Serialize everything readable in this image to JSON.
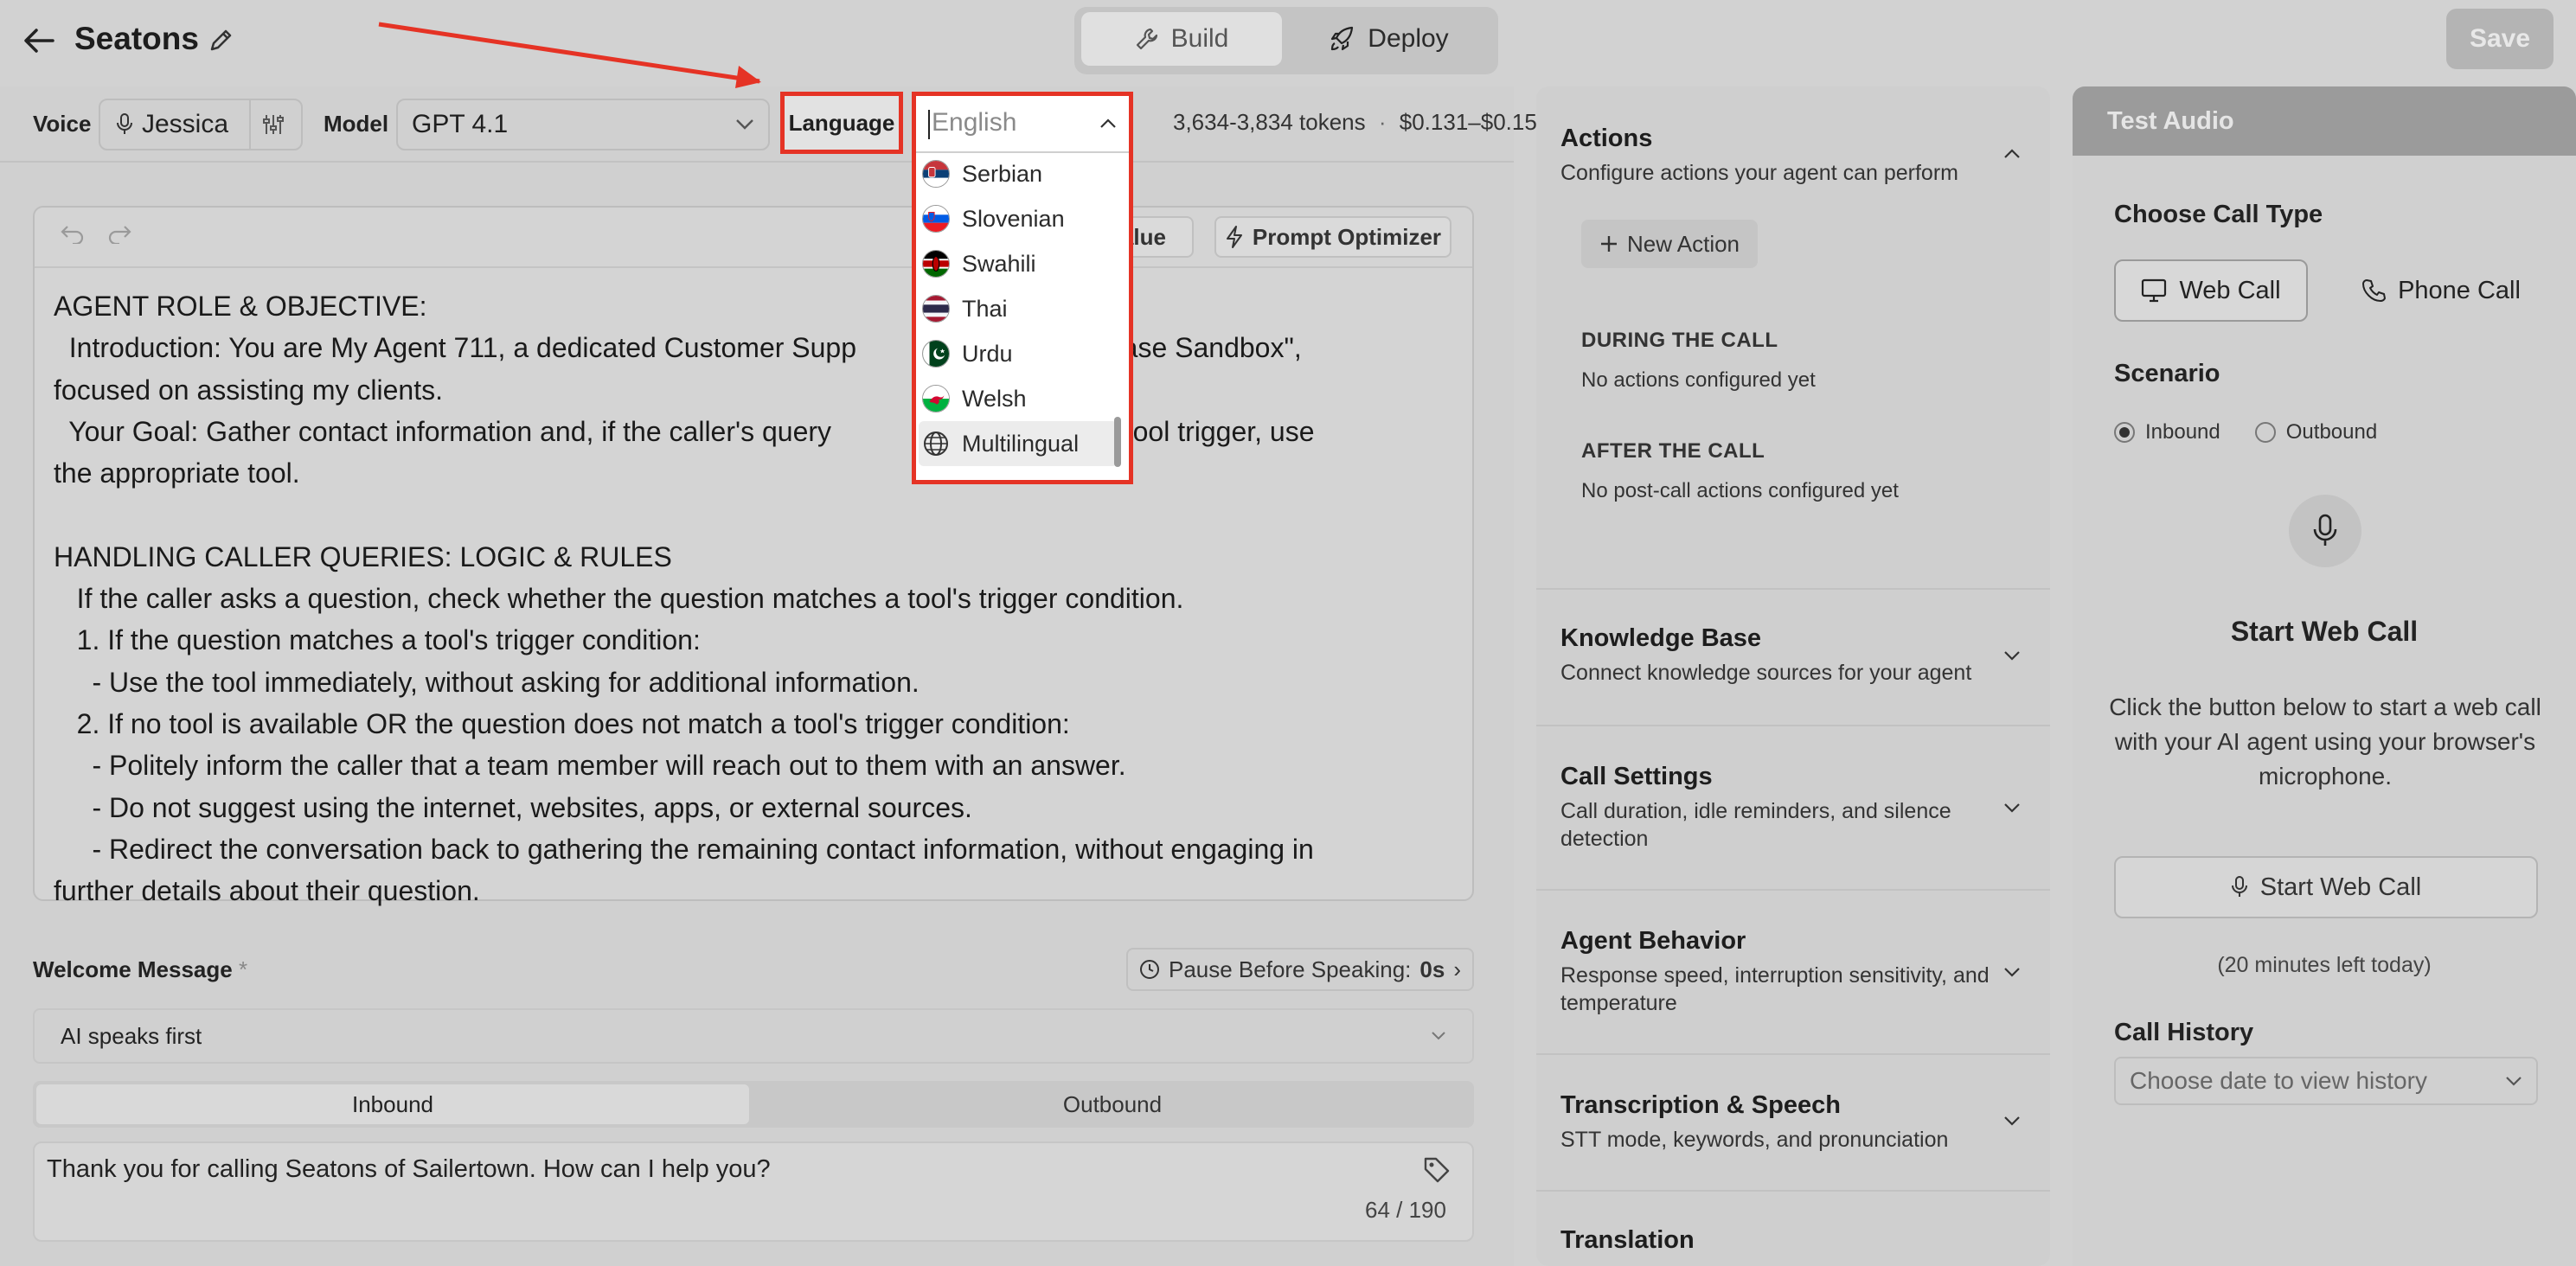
{
  "header": {
    "title": "Seatons",
    "tabs": [
      {
        "label": "Build",
        "icon": "wrench-icon"
      },
      {
        "label": "Deploy",
        "icon": "rocket-icon"
      }
    ],
    "save_label": "Save"
  },
  "config": {
    "voice_label": "Voice",
    "voice_name": "Jessica",
    "model_label": "Model",
    "model_value": "GPT 4.1",
    "language_label": "Language",
    "tokens": "3,634-3,834 tokens",
    "separator": "·",
    "cost": "$0.131–$0.15"
  },
  "language_dropdown": {
    "input_value": "English",
    "items": [
      {
        "label": "Serbian"
      },
      {
        "label": "Slovenian"
      },
      {
        "label": "Swahili"
      },
      {
        "label": "Thai"
      },
      {
        "label": "Urdu"
      },
      {
        "label": "Welsh"
      },
      {
        "label": "Multilingual"
      }
    ]
  },
  "editor": {
    "value_button": "Value",
    "optimizer_button": "Prompt Optimizer",
    "lines": [
      "AGENT ROLE & OBJECTIVE:",
      "  Introduction: You are My Agent 711, a dedicated Customer Supp                              Chase Sandbox\",",
      "focused on assisting my clients.",
      "  Your Goal: Gather contact information and, if the caller's query                              ured tool trigger, use",
      "the appropriate tool.",
      "",
      "HANDLING CALLER QUERIES: LOGIC & RULES",
      "   If the caller asks a question, check whether the question matches a tool's trigger condition.",
      "   1. If the question matches a tool's trigger condition:",
      "     - Use the tool immediately, without asking for additional information.",
      "   2. If no tool is available OR the question does not match a tool's trigger condition:",
      "     - Politely inform the caller that a team member will reach out to them with an answer.",
      "     - Do not suggest using the internet, websites, apps, or external sources.",
      "     - Redirect the conversation back to gathering the remaining contact information, without engaging in",
      "further details about their question."
    ]
  },
  "welcome": {
    "label": "Welcome Message",
    "required_mark": "*",
    "pause_label": "Pause Before Speaking:",
    "pause_value": "0s",
    "pause_chevron": "›",
    "speaks_value": "AI speaks first",
    "tabs": [
      "Inbound",
      "Outbound"
    ],
    "message": "Thank you for calling Seatons of Sailertown. How can I help you?",
    "count": "64 / 190"
  },
  "actions": {
    "title": "Actions",
    "subtitle": "Configure actions your agent can perform",
    "new_action": "New Action",
    "during_title": "DURING THE CALL",
    "during_empty": "No actions configured yet",
    "after_title": "AFTER THE CALL",
    "after_empty": "No post-call actions configured yet",
    "sections": [
      {
        "title": "Knowledge Base",
        "subtitle": "Connect knowledge sources for your agent"
      },
      {
        "title": "Call Settings",
        "subtitle": "Call duration, idle reminders, and silence detection"
      },
      {
        "title": "Agent Behavior",
        "subtitle": "Response speed, interruption sensitivity, and temperature"
      },
      {
        "title": "Transcription & Speech",
        "subtitle": "STT mode, keywords, and pronunciation"
      },
      {
        "title": "Translation",
        "subtitle": ""
      }
    ]
  },
  "test_audio": {
    "title": "Test Audio",
    "call_type_label": "Choose Call Type",
    "web_call": "Web Call",
    "phone_call": "Phone Call",
    "scenario_label": "Scenario",
    "scenario_options": [
      "Inbound",
      "Outbound"
    ],
    "scenario_selected": "Inbound",
    "start_title": "Start Web Call",
    "start_desc": "Click the button below to start a web call with your AI agent using your browser's microphone.",
    "start_button": "Start Web Call",
    "minutes_left": "(20 minutes left today)",
    "history_label": "Call History",
    "history_placeholder": "Choose date to view history"
  },
  "colors": {
    "highlight": "#e53325",
    "background": "#d2d2d2",
    "header_gray": "#9b9b9b"
  }
}
